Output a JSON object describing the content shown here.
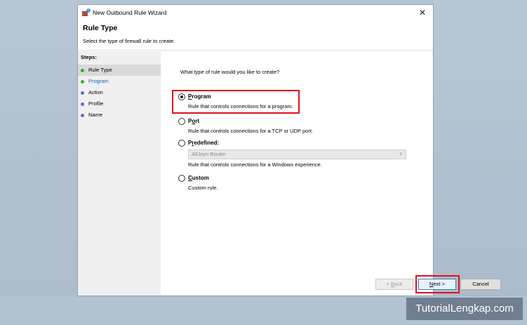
{
  "window": {
    "title": "New Outbound Rule Wizard",
    "close_glyph": "✕"
  },
  "header": {
    "title": "Rule Type",
    "subtitle": "Select the type of firewall rule to create."
  },
  "steps": {
    "heading": "Steps:",
    "items": [
      {
        "label": "Rule Type",
        "state": "active",
        "dot_color": "#2fae2f"
      },
      {
        "label": "Program",
        "state": "link",
        "dot_color": "#2fae2f"
      },
      {
        "label": "Action",
        "state": "pending",
        "dot_color": "#5c6fcf"
      },
      {
        "label": "Profile",
        "state": "pending",
        "dot_color": "#5c6fcf"
      },
      {
        "label": "Name",
        "state": "pending",
        "dot_color": "#5c6fcf"
      }
    ]
  },
  "main": {
    "question": "What type of rule would you like to create?",
    "options": [
      {
        "mnemonic": "P",
        "rest": "rogram",
        "desc": "Rule that controls connections for a program.",
        "checked": true
      },
      {
        "mnemonic": "o",
        "pre": "P",
        "rest": "rt",
        "desc": "Rule that controls connections for a TCP or UDP port.",
        "checked": false
      },
      {
        "mnemonic": "r",
        "pre": "P",
        "rest": "edefined:",
        "desc": "Rule that controls connections for a Windows experience.",
        "checked": false,
        "dropdown_value": "AllJoyn Router"
      },
      {
        "mnemonic": "C",
        "rest": "ustom",
        "desc": "Custom rule.",
        "checked": false
      }
    ]
  },
  "footer": {
    "back_arrow": "< ",
    "back_mnemonic": "B",
    "back_rest": "ack",
    "next_mnemonic": "N",
    "next_rest": "ext",
    "next_arrow": " >",
    "cancel_label": "Cancel"
  },
  "watermark": "TutorialLengkap.com",
  "colors": {
    "highlight": "#e0101c",
    "link": "#1a5fb4"
  }
}
